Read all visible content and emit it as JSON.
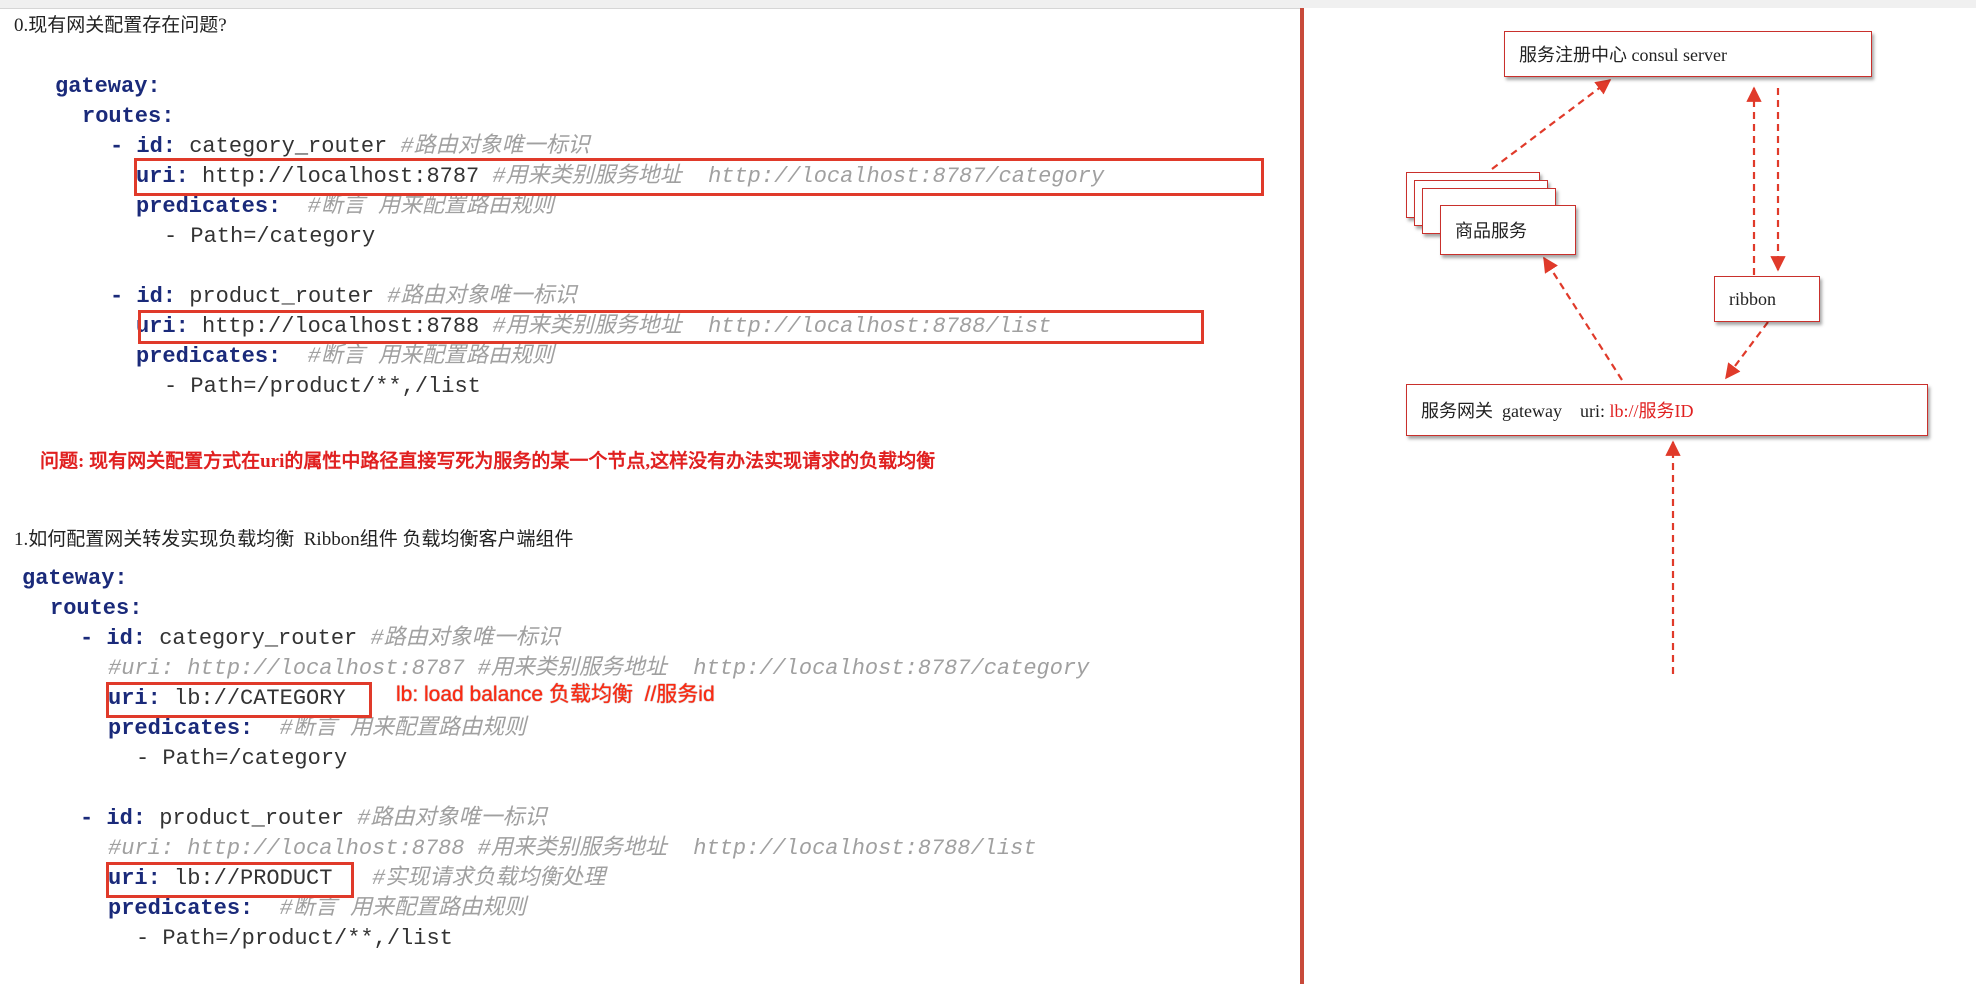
{
  "section0": {
    "heading": "0.现有网关配置存在问题?",
    "gateway_key": "gateway:",
    "routes_key": "routes:",
    "route1": {
      "id_line_key": "- id:",
      "id_value": "category_router",
      "id_comment": "#路由对象唯一标识",
      "uri_key": "uri:",
      "uri_value": "http://localhost:8787",
      "uri_comment": "#用来类别服务地址  http://localhost:8787/category",
      "predicates_key": "predicates:",
      "predicates_comment": "#断言 用来配置路由规则",
      "path": "- Path=/category"
    },
    "route2": {
      "id_line_key": "- id:",
      "id_value": "product_router",
      "id_comment": "#路由对象唯一标识",
      "uri_key": "uri:",
      "uri_value": "http://localhost:8788",
      "uri_comment": "#用来类别服务地址  http://localhost:8788/list",
      "predicates_key": "predicates:",
      "predicates_comment": "#断言 用来配置路由规则",
      "path": "- Path=/product/**,/list"
    },
    "problem": "问题: 现有网关配置方式在uri的属性中路径直接写死为服务的某一个节点,这样没有办法实现请求的负载均衡"
  },
  "section1": {
    "heading": "1.如何配置网关转发实现负载均衡  Ribbon组件 负载均衡客户端组件",
    "gateway_key": "gateway:",
    "routes_key": "routes:",
    "route1": {
      "id_line_key": "- id:",
      "id_value": "category_router",
      "id_comment": "#路由对象唯一标识",
      "commented_uri": "#uri: http://localhost:8787 #用来类别服务地址  http://localhost:8787/category",
      "uri_key": "uri:",
      "uri_value": "lb://CATEGORY",
      "annotation": "lb: load balance 负载均衡  //服务id",
      "predicates_key": "predicates:",
      "predicates_comment": "#断言 用来配置路由规则",
      "path": "- Path=/category"
    },
    "route2": {
      "id_line_key": "- id:",
      "id_value": "product_router",
      "id_comment": "#路由对象唯一标识",
      "commented_uri": "#uri: http://localhost:8788 #用来类别服务地址  http://localhost:8788/list",
      "uri_key": "uri:",
      "uri_value": "lb://PRODUCT",
      "uri_comment": "#实现请求负载均衡处理",
      "predicates_key": "predicates:",
      "predicates_comment": "#断言 用来配置路由规则",
      "path": "- Path=/product/**,/list"
    }
  },
  "diagram": {
    "registry_label": "服务注册中心 consul server",
    "product_service_label": "商品服务",
    "ribbon_label": "ribbon",
    "gateway_prefix": "服务网关  gateway    uri: ",
    "gateway_uri": "lb://服务ID"
  },
  "colors": {
    "keyword": "#1a2a7a",
    "comment": "#a0a0a0",
    "highlight": "#e03a2a",
    "problem": "#e02020",
    "arrow": "#e03a2a"
  }
}
